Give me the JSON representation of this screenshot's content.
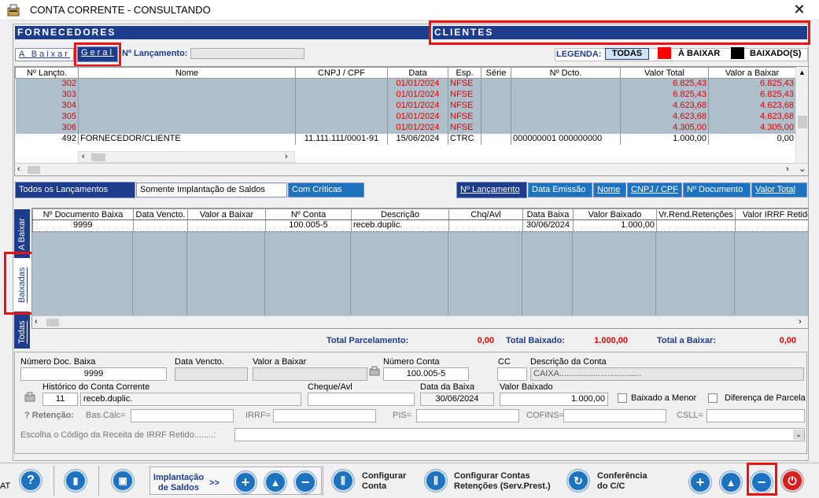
{
  "window": {
    "title": "CONTA CORRENTE  -  CONSULTANDO",
    "close": "✕"
  },
  "headers": {
    "fornecedores": "FORNECEDORES",
    "clientes": "CLIENTES"
  },
  "toolbar": {
    "tab_abaixar": "A Baixar",
    "tab_geral": "Geral",
    "nlanc_label": "Nº Lançamento:",
    "legenda": "LEGENDA:",
    "todas": "TODAS",
    "a_baixar": "À BAIXAR",
    "baixados": "BAIXADO(S)",
    "legend_red": "#ff0000",
    "legend_black": "#000000"
  },
  "top_grid": {
    "columns": [
      "Nº Lançto.",
      "Nome",
      "CNPJ / CPF",
      "Data",
      "Esp.",
      "Série",
      "Nº Dcto.",
      "Valor Total",
      "Valor a Baixar"
    ],
    "rows": [
      [
        "302",
        "",
        "",
        "01/01/2024",
        "NFSE",
        "",
        "",
        "6.825,43",
        "6.825,43"
      ],
      [
        "303",
        "",
        "",
        "01/01/2024",
        "NFSE",
        "",
        "",
        "6.825,43",
        "6.825,43"
      ],
      [
        "304",
        "",
        "",
        "01/01/2024",
        "NFSE",
        "",
        "",
        "4.623,68",
        "4.623,68"
      ],
      [
        "305",
        "",
        "",
        "01/01/2024",
        "NFSE",
        "",
        "",
        "4.623,68",
        "4.623,68"
      ],
      [
        "306",
        "",
        "",
        "01/01/2024",
        "NFSE",
        "",
        "",
        "4.305,00",
        "4.305,00"
      ],
      [
        "492",
        "FORNECEDOR/CLIENTE",
        "11.111.111/0001-91",
        "15/06/2024",
        "CTRC",
        "",
        "000000001    000000000",
        "1.000,00",
        "0,00"
      ]
    ]
  },
  "filters": {
    "todos": "Todos os Lançamentos",
    "somente": "Somente Implantação de Saldos",
    "criticas": "Com Críticas"
  },
  "sort": {
    "nlanc": "Nº Lançamento",
    "emissao": "Data Emissão",
    "nome": "Nome",
    "cnpj": "CNPJ / CPF",
    "ndoc": "Nº Documento",
    "vtotal": "Valor Total"
  },
  "side_tabs": {
    "abaixar": "A Baixar",
    "baixadas": "Baixadas",
    "todas": "Todas"
  },
  "bottom_grid": {
    "columns": [
      "Nº Documento Baixa",
      "Data Vencto.",
      "Valor a Baixar",
      "Nº Conta",
      "Descrição",
      "Chq/Avl",
      "Data Baixa",
      "Valor Baixado",
      "Vr.Rend.Retenções",
      "Valor IRRF Retido"
    ],
    "rows": [
      [
        "9999",
        "",
        "",
        "100.005-5",
        "receb.duplic.",
        "",
        "30/06/2024",
        "1.000,00",
        "",
        ""
      ]
    ]
  },
  "totals": {
    "parcel_label": "Total Parcelamento:",
    "parcel_value": "0,00",
    "baixado_label": "Total Baixado:",
    "baixado_value": "1.000,00",
    "abaixar_label": "Total a Baixar:",
    "abaixar_value": "0,00"
  },
  "form": {
    "ndoc_label": "Número Doc. Baixa",
    "ndoc": "9999",
    "venc_label": "Data Vencto.",
    "vab_label": "Valor a Baixar",
    "nconta_label": "Número Conta",
    "nconta": "100.005-5",
    "cc_label": "CC",
    "desc_conta_label": "Descrição da Conta",
    "desc_conta": "CAIXA..................................",
    "hist_label": "Histórico do Conta Corrente",
    "hist_code": "11",
    "hist_text": "receb.duplic.",
    "chq_label": "Cheque/Avl",
    "dbaixa_label": "Data da Baixa",
    "dbaixa": "30/06/2024",
    "vbaixado_label": "Valor Baixado",
    "vbaixado": "1.000,00",
    "menor_label": "Baixado a Menor",
    "dif_label": "Diferença de Parcela",
    "ret_label": "? Retenção:",
    "bascalc": "Bas.Cálc=",
    "irrf": "IRRF=",
    "pis": "PIS=",
    "cofins": "COFINS=",
    "csll": "CSLL=",
    "irrf_receita": "Escolha o Código da Receita de IRRF Retido........:"
  },
  "footer": {
    "impl1": "Implantação",
    "impl2": "de Saldos",
    "arrows": ">>",
    "conf1": "Configurar",
    "conf2": "Conta",
    "ret1": "Configurar Contas",
    "ret2": "Retenções (Serv.Prest.)",
    "cc1": "Conferência",
    "cc2": "do C/C",
    "edge": "AT"
  }
}
